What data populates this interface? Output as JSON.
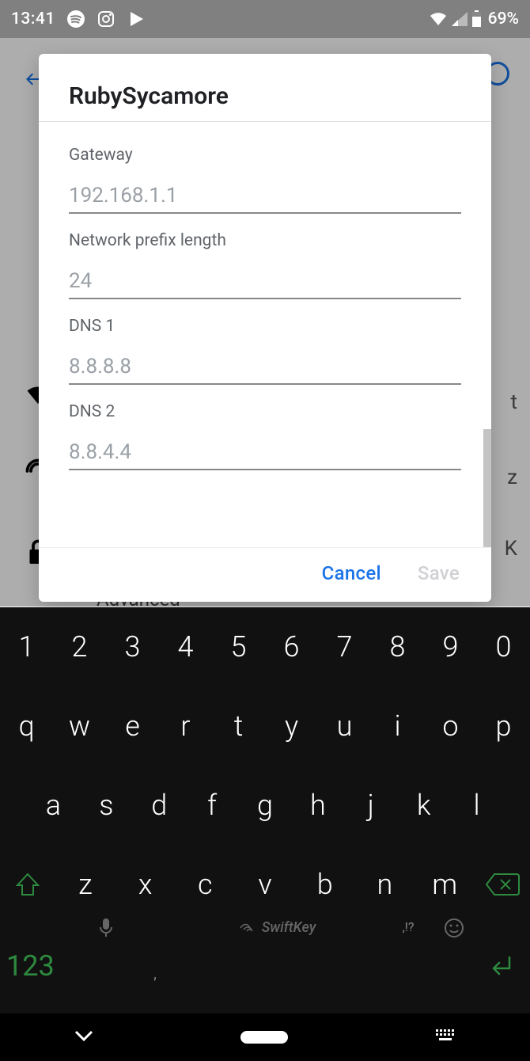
{
  "status": {
    "time": "13:41",
    "battery_pct": "69%"
  },
  "background": {
    "advanced_label": "Advanced",
    "row1_suffix": "t",
    "row2_suffix": "z",
    "row3_suffix": "K"
  },
  "dialog": {
    "title": "RubySycamore",
    "fields": {
      "gateway": {
        "label": "Gateway",
        "placeholder": "192.168.1.1",
        "value": ""
      },
      "prefix": {
        "label": "Network prefix length",
        "placeholder": "24",
        "value": ""
      },
      "dns1": {
        "label": "DNS 1",
        "placeholder": "8.8.8.8",
        "value": ""
      },
      "dns2": {
        "label": "DNS 2",
        "placeholder": "8.8.4.4",
        "value": ""
      }
    },
    "actions": {
      "cancel": "Cancel",
      "save": "Save"
    }
  },
  "keyboard": {
    "row1": [
      "1",
      "2",
      "3",
      "4",
      "5",
      "6",
      "7",
      "8",
      "9",
      "0"
    ],
    "row2": [
      "q",
      "w",
      "e",
      "r",
      "t",
      "y",
      "u",
      "i",
      "o",
      "p"
    ],
    "row3": [
      "a",
      "s",
      "d",
      "f",
      "g",
      "h",
      "j",
      "k",
      "l"
    ],
    "row4": [
      "z",
      "x",
      "c",
      "v",
      "b",
      "n",
      "m"
    ],
    "mode_key": "123",
    "brand": "SwiftKey",
    "punct_right": ",!?",
    "punct_left": ","
  }
}
